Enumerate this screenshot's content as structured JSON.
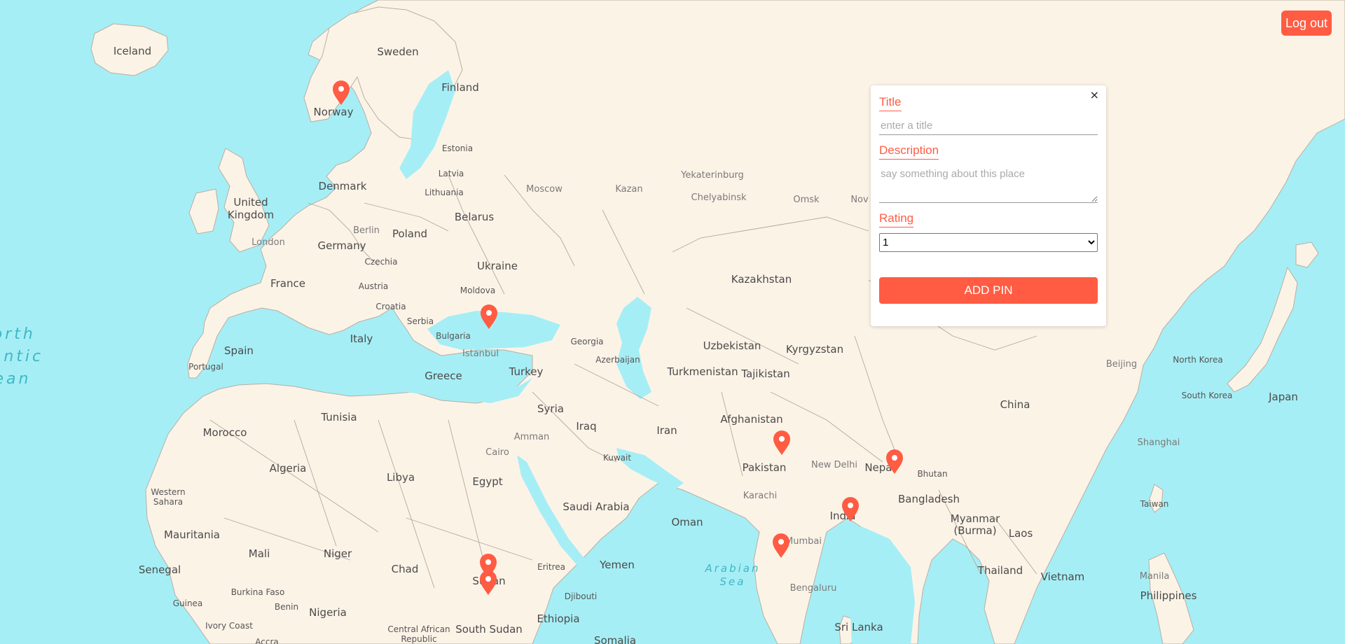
{
  "header": {
    "logout_label": "Log out"
  },
  "form": {
    "close_symbol": "×",
    "title_label": "Title",
    "title_placeholder": "enter a title",
    "description_label": "Description",
    "description_placeholder": "say something about this place",
    "rating_label": "Rating",
    "rating_value": "1",
    "rating_options": [
      "1"
    ],
    "submit_label": "ADD PIN"
  },
  "map": {
    "water_color": "#a6eef5",
    "land_color": "#fcf3e7",
    "pin_color": "#ff5c43",
    "pin_icon": "map-pin-icon",
    "labels": {
      "iceland": "Iceland",
      "sweden": "Sweden",
      "finland": "Finland",
      "norway": "Norway",
      "estonia": "Estonia",
      "latvia": "Latvia",
      "lithuania": "Lithuania",
      "denmark": "Denmark",
      "moscow": "Moscow",
      "kazan": "Kazan",
      "yekaterinburg": "Yekaterinburg",
      "chelyabinsk": "Chelyabinsk",
      "omsk": "Omsk",
      "nov": "Nov",
      "united": "United",
      "kingdom": "Kingdom",
      "london": "London",
      "berlin": "Berlin",
      "poland": "Poland",
      "belarus": "Belarus",
      "germany": "Germany",
      "czechia": "Czechia",
      "ukraine": "Ukraine",
      "france": "France",
      "austria": "Austria",
      "moldova": "Moldova",
      "kazakhstan": "Kazakhstan",
      "croatia": "Croatia",
      "serbia": "Serbia",
      "bulgaria": "Bulgaria",
      "italy": "Italy",
      "spain": "Spain",
      "portugal": "Portugal",
      "istanbul": "Istanbul",
      "georgia": "Georgia",
      "azerbaijan": "Azerbaijan",
      "uzbekistan": "Uzbekistan",
      "kyrgyzstan": "Kyrgyzstan",
      "turkey": "Turkey",
      "greece": "Greece",
      "turkmenistan": "Turkmenistan",
      "tajikistan": "Tajikistan",
      "beijing": "Beijing",
      "north_korea": "North Korea",
      "south_korea": "South Korea",
      "japan": "Japan",
      "china": "China",
      "north": "North",
      "antic": "antic",
      "ean": "ean",
      "morocco": "Morocco",
      "tunisia": "Tunisia",
      "algeria": "Algeria",
      "libya": "Libya",
      "syria": "Syria",
      "iraq": "Iraq",
      "iran": "Iran",
      "afghanistan": "Afghanistan",
      "cairo": "Cairo",
      "amman": "Amman",
      "kuwait": "Kuwait",
      "egypt": "Egypt",
      "pakistan": "Pakistan",
      "new_delhi": "New Delhi",
      "nepal": "Nepal",
      "bhutan": "Bhutan",
      "shanghai": "Shanghai",
      "western": "Western",
      "sahara": "Sahara",
      "saudi_arabia": "Saudi Arabia",
      "karachi": "Karachi",
      "bangladesh": "Bangladesh",
      "oman": "Oman",
      "india": "India",
      "myanmar": "Myanmar",
      "burma": "(Burma)",
      "laos": "Laos",
      "taiwan": "Taiwan",
      "mauritania": "Mauritania",
      "mali": "Mali",
      "niger": "Niger",
      "mumbai": "Mumbai",
      "chad": "Chad",
      "eritrea": "Eritrea",
      "yemen": "Yemen",
      "arabian": "Arabian",
      "sea": "Sea",
      "senegal": "Senegal",
      "sudan": "Sudan",
      "thailand": "Thailand",
      "manila": "Manila",
      "vietnam": "Vietnam",
      "burkina_faso": "Burkina Faso",
      "djibouti": "Djibouti",
      "bengaluru": "Bengaluru",
      "philippines": "Philippines",
      "guinea": "Guinea",
      "benin": "Benin",
      "nigeria": "Nigeria",
      "ethiopia": "Ethiopia",
      "ivory_coast": "Ivory Coast",
      "central_african": "Central African",
      "republic": "Republic",
      "south_sudan": "South Sudan",
      "sri_lanka": "Sri Lanka",
      "accra": "Accra",
      "somalia": "Somalia"
    }
  }
}
